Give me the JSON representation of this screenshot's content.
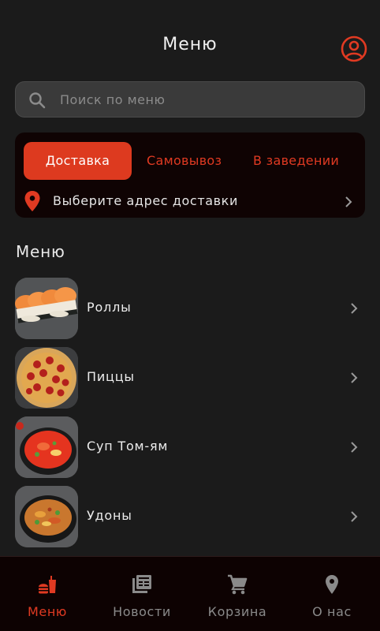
{
  "header": {
    "title": "Меню"
  },
  "search": {
    "placeholder": "Поиск по меню",
    "value": ""
  },
  "delivery": {
    "tabs": [
      {
        "label": "Доставка",
        "active": true
      },
      {
        "label": "Самовывоз",
        "active": false
      },
      {
        "label": "В заведении",
        "active": false
      }
    ],
    "address_prompt": "Выберите адрес доставки"
  },
  "section_title": "Меню",
  "menu_items": [
    {
      "label": "Роллы",
      "image": "rolls-photo"
    },
    {
      "label": "Пиццы",
      "image": "pizza-photo"
    },
    {
      "label": "Суп Том-ям",
      "image": "tom-yum-soup-photo"
    },
    {
      "label": "Удоны",
      "image": "udon-photo"
    }
  ],
  "bottom_nav": [
    {
      "label": "Меню",
      "icon": "fastfood-icon",
      "active": true
    },
    {
      "label": "Новости",
      "icon": "news-icon",
      "active": false
    },
    {
      "label": "Корзина",
      "icon": "cart-icon",
      "active": false
    },
    {
      "label": "О нас",
      "icon": "location-icon",
      "active": false
    }
  ],
  "colors": {
    "accent": "#dd3a1f",
    "background": "#1b1b1b",
    "panel": "#0f0303",
    "inactive_nav": "#8a8a8a"
  }
}
